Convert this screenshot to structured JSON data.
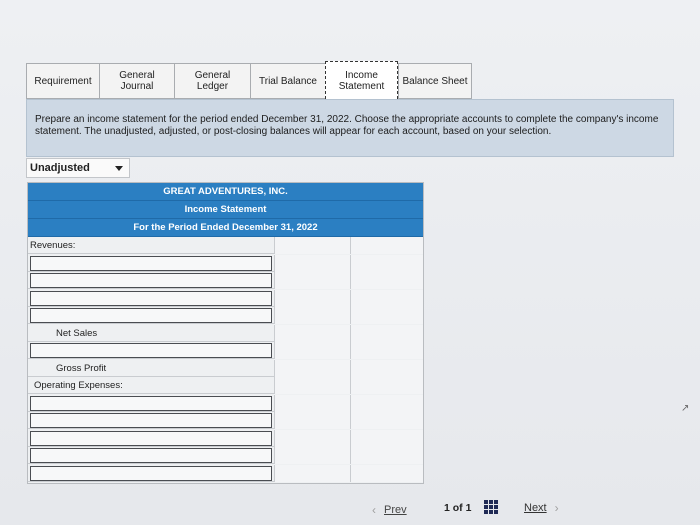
{
  "tabs": [
    {
      "line1": "Requirement",
      "line2": ""
    },
    {
      "line1": "General",
      "line2": "Journal"
    },
    {
      "line1": "General",
      "line2": "Ledger"
    },
    {
      "line1": "Trial Balance",
      "line2": ""
    },
    {
      "line1": "Income",
      "line2": "Statement"
    },
    {
      "line1": "Balance Sheet",
      "line2": ""
    }
  ],
  "instructions": "Prepare an income statement for the period ended December 31, 2022. Choose the appropriate accounts to complete the company's income statement. The unadjusted, adjusted, or post-closing balances will appear for each account, based on your selection.",
  "balance_selector": {
    "selected": "Unadjusted"
  },
  "statement": {
    "company": "GREAT ADVENTURES, INC.",
    "title": "Income Statement",
    "period": "For the Period Ended December 31, 2022",
    "labels": {
      "revenues": "Revenues:",
      "net_sales": "Net Sales",
      "gross_profit": "Gross Profit",
      "operating_expenses": "Operating Expenses:"
    }
  },
  "footer": {
    "prev": "Prev",
    "page": "1",
    "of": "of",
    "total": "1",
    "next": "Next"
  },
  "colors": {
    "header_blue": "#2b7fc2",
    "instructions_bg": "#cdd8e4"
  }
}
